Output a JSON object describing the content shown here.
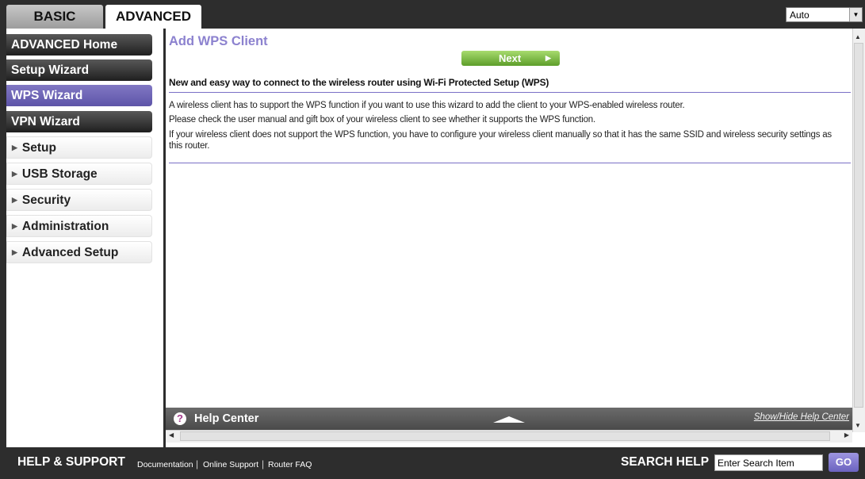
{
  "tabs": {
    "basic": "BASIC",
    "advanced": "ADVANCED"
  },
  "language": {
    "selected": "Auto"
  },
  "sidebar": {
    "items": [
      {
        "label": "ADVANCED Home",
        "style": "dark"
      },
      {
        "label": "Setup Wizard",
        "style": "dark"
      },
      {
        "label": "WPS Wizard",
        "style": "active"
      },
      {
        "label": "VPN Wizard",
        "style": "dark"
      },
      {
        "label": "Setup",
        "style": "expandable"
      },
      {
        "label": "USB Storage",
        "style": "expandable"
      },
      {
        "label": "Security",
        "style": "expandable"
      },
      {
        "label": "Administration",
        "style": "expandable"
      },
      {
        "label": "Advanced Setup",
        "style": "expandable"
      }
    ]
  },
  "main": {
    "title": "Add WPS Client",
    "next_label": "Next",
    "heading": "New and easy way to connect to the wireless router using Wi-Fi Protected Setup (WPS)",
    "paragraphs": [
      "A wireless client has to support the WPS function if you want to use this wizard to add the client to your WPS-enabled wireless router.",
      "Please check the user manual and gift box of your wireless client to see whether it supports the WPS function.",
      "If your wireless client does not support the WPS function, you have to configure your wireless client manually so that it has the same SSID and wireless security settings as this router."
    ]
  },
  "help_center": {
    "title": "Help Center",
    "toggle_label": "Show/Hide Help Center"
  },
  "footer": {
    "title": "HELP & SUPPORT",
    "links": [
      "Documentation",
      "Online Support",
      "Router FAQ"
    ],
    "search_label": "SEARCH HELP",
    "search_placeholder": "Enter Search Item",
    "go_label": "GO"
  },
  "colors": {
    "accent_purple": "#8c82cf",
    "next_green": "#6fb33a",
    "dark_bg": "#2d2d2d"
  }
}
